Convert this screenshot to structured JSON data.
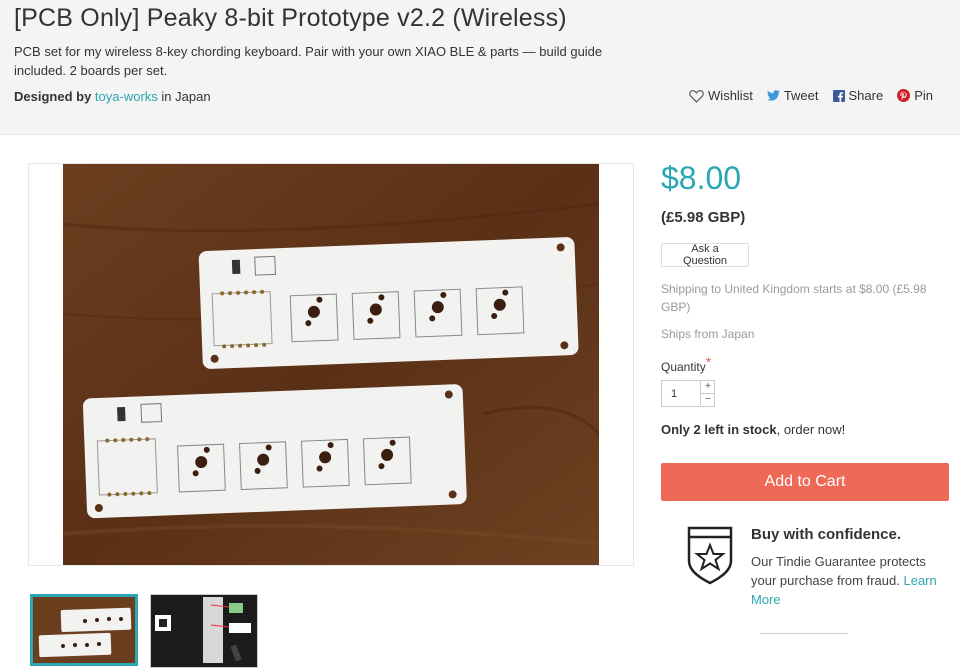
{
  "product": {
    "title": "[PCB Only] Peaky 8-bit Prototype v2.2 (Wireless)",
    "subtitle": "PCB set for my wireless 8-key chording keyboard. Pair with your own XIAO BLE & parts — build guide included. 2 boards per set.",
    "designed_by_label": "Designed by",
    "designer": "toya-works",
    "designer_location": "in Japan"
  },
  "social": {
    "wishlist": "Wishlist",
    "tweet": "Tweet",
    "share": "Share",
    "pin": "Pin"
  },
  "pricing": {
    "price": "$8.00",
    "price_gbp": "(£5.98 GBP)",
    "ask_question": "Ask a Question",
    "shipping": "Shipping to United Kingdom starts at $8.00 (£5.98 GBP)",
    "ships_from": "Ships from Japan",
    "quantity_label": "Quantity",
    "required_mark": "*",
    "quantity_value": "1",
    "stock_bold": "Only 2 left in stock",
    "stock_rest": ", order now!",
    "add_to_cart": "Add to Cart"
  },
  "guarantee": {
    "title": "Buy with confidence.",
    "text": "Our Tindie Guarantee protects your purchase from fraud.",
    "link": "Learn More"
  },
  "colors": {
    "accent": "#2ba6b5",
    "cart_button": "#ee6a56"
  },
  "icons": {
    "wishlist": "heart-icon",
    "tweet": "twitter-icon",
    "share": "facebook-icon",
    "pin": "pinterest-icon",
    "guarantee": "shield-star-icon"
  },
  "gallery": {
    "thumbnail_count": 2,
    "selected_index": 0
  }
}
